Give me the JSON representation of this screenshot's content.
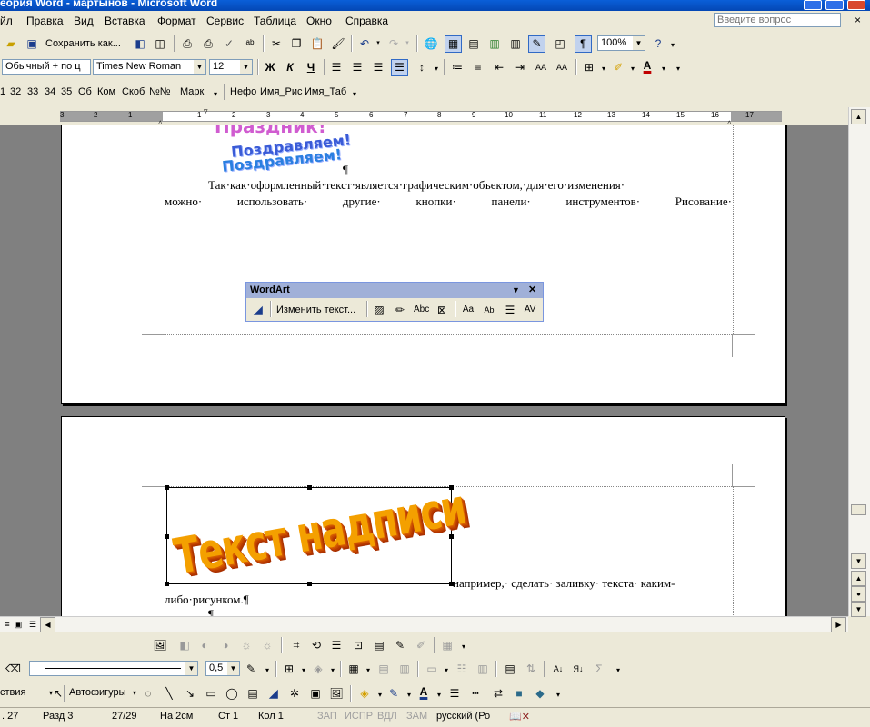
{
  "window": {
    "title": "еория Word - мартынов - Microsoft Word"
  },
  "menu": [
    "йл",
    "Правка",
    "Вид",
    "Вставка",
    "Формат",
    "Сервис",
    "Таблица",
    "Окно",
    "Справка"
  ],
  "help_box": {
    "placeholder": "Введите вопрос",
    "close": "×"
  },
  "standard_toolbar": {
    "save_as_label": "Сохранить как...",
    "zoom": "100%"
  },
  "format_toolbar": {
    "style": "Обычный + по ц",
    "font": "Times New Roman",
    "size": "12"
  },
  "macro_toolbar": {
    "items": [
      "1",
      "32",
      "33",
      "34",
      "35",
      "Об",
      "Ком",
      "Скоб",
      "№№",
      "Марк",
      "Нефо",
      "Имя_Рис",
      "Имя_Таб"
    ]
  },
  "ruler": {
    "labels": [
      "3",
      "2",
      "1",
      "1",
      "2",
      "3",
      "4",
      "5",
      "6",
      "7",
      "8",
      "9",
      "10",
      "11",
      "12",
      "13",
      "14",
      "15",
      "16",
      "17"
    ]
  },
  "document": {
    "wordart_top_1": "Праздник!",
    "wordart_top_2": "Поздравляем!",
    "wordart_top_3": "Поздравляем!",
    "pilcrow": "¶",
    "para1_line1": "Так·как·оформленный·текст·является·графическим·объектом,·для·его·изменения·",
    "para1_line2_words": [
      "можно·",
      "использовать·",
      "другие·",
      "кнопки·",
      "панели·",
      "инструментов·",
      "Рисование·"
    ],
    "wordart_main": "Текст надписи",
    "para2_line1": "например,· сделать· заливку· текста· каким-",
    "para2_line2": "либо·рисунком.¶",
    "pilcrow2": "¶"
  },
  "wordart_toolbar": {
    "title": "WordArt",
    "edit_text": "Изменить текст...",
    "close": "✕",
    "menu_arrow": "▼"
  },
  "drawing_toolbar": {
    "line_width": "0,5",
    "autoshapes": "Автофигуры",
    "actions": "ствия"
  },
  "status": {
    "page": ". 27",
    "section": "Разд 3",
    "pages": "27/29",
    "at": "На 2см",
    "line": "Ст 1",
    "col": "Кол 1",
    "rec": "ЗАП",
    "trk": "ИСПР",
    "ext": "ВДЛ",
    "ovr": "ЗАМ",
    "language": "русский (Ро"
  }
}
